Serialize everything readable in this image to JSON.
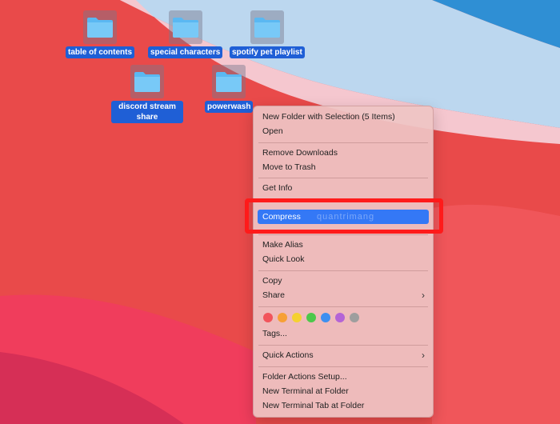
{
  "desktop_icons": [
    {
      "label": "table of contents"
    },
    {
      "label": "special characters"
    },
    {
      "label": "spotify pet playlist"
    },
    {
      "label": "discord stream share"
    },
    {
      "label": "powerwash"
    }
  ],
  "watermark": "quantrimang",
  "context_menu": {
    "items": [
      "New Folder with Selection (5 Items)",
      "Open",
      "Remove Downloads",
      "Move to Trash",
      "Get Info",
      "Compress",
      "Make Alias",
      "Quick Look",
      "Copy",
      "Share",
      "Tags...",
      "Quick Actions",
      "Folder Actions Setup...",
      "New Terminal at Folder",
      "New Terminal Tab at Folder"
    ],
    "highlighted": "Compress",
    "tag_colors": [
      "#f2545b",
      "#f7a035",
      "#f5d130",
      "#4cc84a",
      "#3d8ff0",
      "#b464d6",
      "#9e9e9e"
    ],
    "callout_color": "#ff1a1a"
  }
}
